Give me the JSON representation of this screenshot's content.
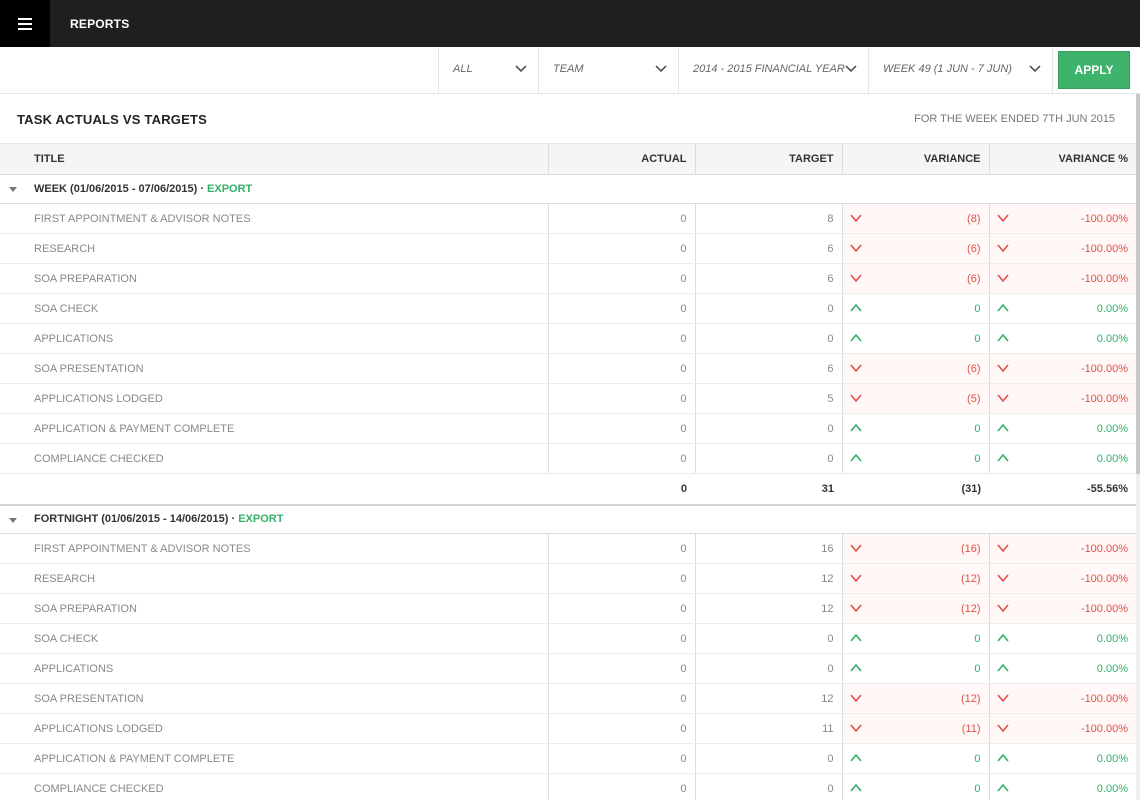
{
  "header": {
    "title": "REPORTS",
    "menu_icon": "hamburger-menu-icon"
  },
  "filters": [
    {
      "value": "ALL",
      "icon": "chevron-down-icon"
    },
    {
      "value": "TEAM",
      "icon": "chevron-down-icon"
    },
    {
      "value": "2014 - 2015 FINANCIAL YEAR",
      "icon": "chevron-down-icon"
    },
    {
      "value": "WEEK 49 (1 JUN - 7 JUN)",
      "icon": "chevron-down-icon"
    }
  ],
  "apply_label": "APPLY",
  "report": {
    "title": "TASK ACTUALS VS TARGETS",
    "subtitle": "FOR THE WEEK ENDED 7TH JUN 2015",
    "columns": [
      "TITLE",
      "ACTUAL",
      "TARGET",
      "VARIANCE",
      "VARIANCE %"
    ],
    "groups": [
      {
        "label": "WEEK (01/06/2015 - 07/06/2015) · ",
        "export_label": "EXPORT",
        "rows": [
          {
            "title": "FIRST APPOINTMENT & ADVISOR NOTES",
            "actual": "0",
            "target": "8",
            "variance": "(8)",
            "variance_pct": "-100.00%",
            "status": "down"
          },
          {
            "title": "RESEARCH",
            "actual": "0",
            "target": "6",
            "variance": "(6)",
            "variance_pct": "-100.00%",
            "status": "down"
          },
          {
            "title": "SOA PREPARATION",
            "actual": "0",
            "target": "6",
            "variance": "(6)",
            "variance_pct": "-100.00%",
            "status": "down"
          },
          {
            "title": "SOA CHECK",
            "actual": "0",
            "target": "0",
            "variance": "0",
            "variance_pct": "0.00%",
            "status": "up"
          },
          {
            "title": "APPLICATIONS",
            "actual": "0",
            "target": "0",
            "variance": "0",
            "variance_pct": "0.00%",
            "status": "up"
          },
          {
            "title": "SOA PRESENTATION",
            "actual": "0",
            "target": "6",
            "variance": "(6)",
            "variance_pct": "-100.00%",
            "status": "down"
          },
          {
            "title": "APPLICATIONS LODGED",
            "actual": "0",
            "target": "5",
            "variance": "(5)",
            "variance_pct": "-100.00%",
            "status": "down"
          },
          {
            "title": "APPLICATION & PAYMENT COMPLETE",
            "actual": "0",
            "target": "0",
            "variance": "0",
            "variance_pct": "0.00%",
            "status": "up"
          },
          {
            "title": "COMPLIANCE CHECKED",
            "actual": "0",
            "target": "0",
            "variance": "0",
            "variance_pct": "0.00%",
            "status": "up"
          }
        ],
        "total": {
          "actual": "0",
          "target": "31",
          "variance": "(31)",
          "variance_pct": "-55.56%"
        }
      },
      {
        "label": "FORTNIGHT (01/06/2015 - 14/06/2015) · ",
        "export_label": "EXPORT",
        "rows": [
          {
            "title": "FIRST APPOINTMENT & ADVISOR NOTES",
            "actual": "0",
            "target": "16",
            "variance": "(16)",
            "variance_pct": "-100.00%",
            "status": "down"
          },
          {
            "title": "RESEARCH",
            "actual": "0",
            "target": "12",
            "variance": "(12)",
            "variance_pct": "-100.00%",
            "status": "down"
          },
          {
            "title": "SOA PREPARATION",
            "actual": "0",
            "target": "12",
            "variance": "(12)",
            "variance_pct": "-100.00%",
            "status": "down"
          },
          {
            "title": "SOA CHECK",
            "actual": "0",
            "target": "0",
            "variance": "0",
            "variance_pct": "0.00%",
            "status": "up"
          },
          {
            "title": "APPLICATIONS",
            "actual": "0",
            "target": "0",
            "variance": "0",
            "variance_pct": "0.00%",
            "status": "up"
          },
          {
            "title": "SOA PRESENTATION",
            "actual": "0",
            "target": "12",
            "variance": "(12)",
            "variance_pct": "-100.00%",
            "status": "down"
          },
          {
            "title": "APPLICATIONS LODGED",
            "actual": "0",
            "target": "11",
            "variance": "(11)",
            "variance_pct": "-100.00%",
            "status": "down"
          },
          {
            "title": "APPLICATION & PAYMENT COMPLETE",
            "actual": "0",
            "target": "0",
            "variance": "0",
            "variance_pct": "0.00%",
            "status": "up"
          },
          {
            "title": "COMPLIANCE CHECKED",
            "actual": "0",
            "target": "0",
            "variance": "0",
            "variance_pct": "0.00%",
            "status": "up"
          }
        ]
      }
    ]
  },
  "colors": {
    "accent": "#3db36b",
    "negative": "#e0524a",
    "positive": "#34b06a",
    "topbar": "#1f1f1f"
  }
}
